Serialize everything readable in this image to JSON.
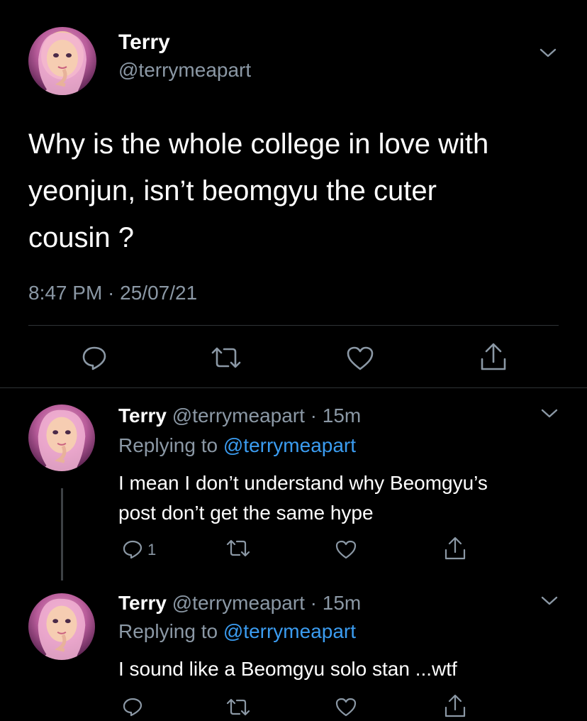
{
  "main_tweet": {
    "display_name": "Terry",
    "handle": "@terrymeapart",
    "text_lines": [
      "Why is the whole college in love with",
      "yeonjun, isn’t beomgyu the cuter",
      "cousin ?"
    ],
    "timestamp": "8:47 PM · 25/07/21"
  },
  "replies": [
    {
      "display_name": "Terry",
      "handle_time": "@terrymeapart · 15m",
      "replying_prefix": "Replying to",
      "replying_to": "@terrymeapart",
      "text_lines": [
        "I mean I don’t understand why Beomgyu’s",
        "post don’t get the same hype"
      ],
      "reply_count": "1"
    },
    {
      "display_name": "Terry",
      "handle_time": "@terrymeapart · 15m",
      "replying_prefix": "Replying to",
      "replying_to": "@terrymeapart",
      "text_lines": [
        "I sound like a Beomgyu solo stan ...wtf"
      ],
      "reply_count": ""
    }
  ],
  "icons": {
    "reply": "reply-icon",
    "retweet": "retweet-icon",
    "like": "heart-icon",
    "share": "share-icon",
    "more": "chevron-down-icon"
  },
  "colors": {
    "background": "#000000",
    "text": "#ffffff",
    "muted": "#8b98a5",
    "link": "#3b9cf0",
    "divider": "#2f3336"
  }
}
